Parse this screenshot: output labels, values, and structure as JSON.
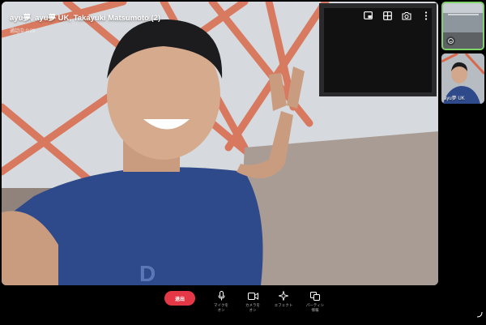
{
  "call": {
    "title": "ayu夢, ayu夢 UK, Takayuki Matsumoto (2)",
    "subtitle": "通話中 0:29"
  },
  "top_icons": [
    "picture-in-picture-icon",
    "grid-layout-icon",
    "camera-switch-icon",
    "more-vertical-icon"
  ],
  "participants": [
    {
      "label": ""
    },
    {
      "label": "ayu夢 UK"
    }
  ],
  "controls": {
    "leave_label": "退出",
    "mic_label": "マイクを\nオン",
    "camera_label": "カメラを\nオン",
    "effects_label": "エフェクト",
    "participants_label": "パーティシ\n情報"
  },
  "colors": {
    "leave_button": "#e53847",
    "active_speaker_border": "#7fd36a",
    "background": "#000000"
  }
}
